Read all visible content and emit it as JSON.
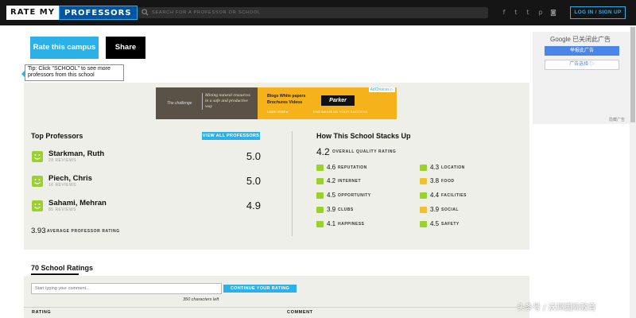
{
  "nav": {
    "logo_left": "RATE MY",
    "logo_right": "PROFESSORS",
    "search_placeholder": "SEARCH FOR A PROFESSOR OR SCHOOL",
    "social_icons": [
      "facebook-icon",
      "twitter-icon",
      "tumblr-icon",
      "pinterest-icon",
      "instagram-icon"
    ],
    "social_glyphs": [
      "f",
      "t",
      "t",
      "p",
      "◙"
    ],
    "login_label": "LOG IN / SIGN UP"
  },
  "actions": {
    "rate_label": "Rate this campus",
    "share_label": "Share"
  },
  "tip": {
    "text": "Tip: Click \"SCHOOL\" to see more professors from this school"
  },
  "side_ad": {
    "google": "Google 已关闭此广告",
    "report": "举报此广告",
    "choice": "广告选择 ▷",
    "tag": "隐藏广告"
  },
  "ad_banner": {
    "challenge": "The challenge",
    "message": "Mining natural resources in a safe and productive way",
    "topics": "Blogs  White papers  Brochures  Videos",
    "learn_more": "Learn more ▸",
    "brand": "Parker",
    "tagline": "ENGINEERING YOUR SUCCESS.",
    "adchoices": "AdChoices ▷"
  },
  "top_professors": {
    "title": "Top Professors",
    "view_all_label": "VIEW ALL PROFESSORS",
    "professors": [
      {
        "name": "Starkman, Ruth",
        "reviews": "28 REVIEWS",
        "score": "5.0"
      },
      {
        "name": "Piech, Chris",
        "reviews": "16 REVIEWS",
        "score": "5.0"
      },
      {
        "name": "Sahami, Mehran",
        "reviews": "85 REVIEWS",
        "score": "4.9"
      }
    ],
    "average_value": "3.93",
    "average_label": "AVERAGE PROFESSOR RATING"
  },
  "school_stats": {
    "title": "How This School Stacks Up",
    "overall_value": "4.2",
    "overall_label": "OVERALL QUALITY RATING",
    "left_col": [
      {
        "value": "4.6",
        "label": "REPUTATION"
      },
      {
        "value": "4.2",
        "label": "INTERNET"
      },
      {
        "value": "4.5",
        "label": "OPPORTUNITY"
      },
      {
        "value": "3.9",
        "label": "CLUBS"
      },
      {
        "value": "4.1",
        "label": "HAPPINESS"
      }
    ],
    "right_col": [
      {
        "value": "4.3",
        "label": "LOCATION"
      },
      {
        "value": "3.8",
        "label": "FOOD"
      },
      {
        "value": "4.4",
        "label": "FACILITIES"
      },
      {
        "value": "3.9",
        "label": "SOCIAL"
      },
      {
        "value": "4.5",
        "label": "SAFETY"
      }
    ]
  },
  "ratings": {
    "title": "70 School Ratings",
    "comment_placeholder": "Start typing your comment...",
    "continue_label": "CONTINUE YOUR RATING",
    "chars_left": "350 characters left",
    "col_rating": "RATING",
    "col_comment": "COMMENT"
  },
  "watermark": "头条号 / 沃邦国际教育",
  "colors": {
    "accent": "#2bb0e8",
    "good": "#9bd12e",
    "nav_bg": "#151515"
  }
}
